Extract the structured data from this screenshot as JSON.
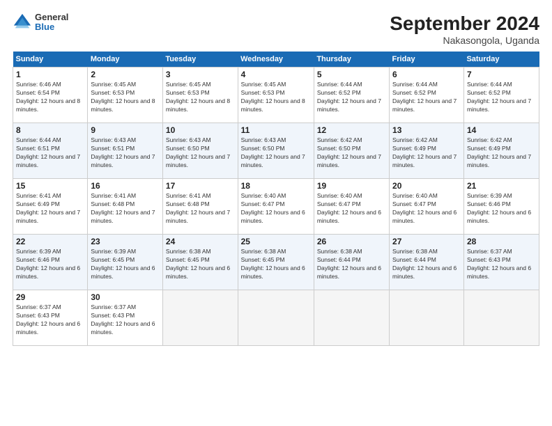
{
  "header": {
    "logo_general": "General",
    "logo_blue": "Blue",
    "month_title": "September 2024",
    "location": "Nakasongola, Uganda"
  },
  "days_of_week": [
    "Sunday",
    "Monday",
    "Tuesday",
    "Wednesday",
    "Thursday",
    "Friday",
    "Saturday"
  ],
  "weeks": [
    [
      {
        "day": 1,
        "sunrise": "6:46 AM",
        "sunset": "6:54 PM",
        "daylight": "12 hours and 8 minutes."
      },
      {
        "day": 2,
        "sunrise": "6:45 AM",
        "sunset": "6:53 PM",
        "daylight": "12 hours and 8 minutes."
      },
      {
        "day": 3,
        "sunrise": "6:45 AM",
        "sunset": "6:53 PM",
        "daylight": "12 hours and 8 minutes."
      },
      {
        "day": 4,
        "sunrise": "6:45 AM",
        "sunset": "6:53 PM",
        "daylight": "12 hours and 8 minutes."
      },
      {
        "day": 5,
        "sunrise": "6:44 AM",
        "sunset": "6:52 PM",
        "daylight": "12 hours and 7 minutes."
      },
      {
        "day": 6,
        "sunrise": "6:44 AM",
        "sunset": "6:52 PM",
        "daylight": "12 hours and 7 minutes."
      },
      {
        "day": 7,
        "sunrise": "6:44 AM",
        "sunset": "6:52 PM",
        "daylight": "12 hours and 7 minutes."
      }
    ],
    [
      {
        "day": 8,
        "sunrise": "6:44 AM",
        "sunset": "6:51 PM",
        "daylight": "12 hours and 7 minutes."
      },
      {
        "day": 9,
        "sunrise": "6:43 AM",
        "sunset": "6:51 PM",
        "daylight": "12 hours and 7 minutes."
      },
      {
        "day": 10,
        "sunrise": "6:43 AM",
        "sunset": "6:50 PM",
        "daylight": "12 hours and 7 minutes."
      },
      {
        "day": 11,
        "sunrise": "6:43 AM",
        "sunset": "6:50 PM",
        "daylight": "12 hours and 7 minutes."
      },
      {
        "day": 12,
        "sunrise": "6:42 AM",
        "sunset": "6:50 PM",
        "daylight": "12 hours and 7 minutes."
      },
      {
        "day": 13,
        "sunrise": "6:42 AM",
        "sunset": "6:49 PM",
        "daylight": "12 hours and 7 minutes."
      },
      {
        "day": 14,
        "sunrise": "6:42 AM",
        "sunset": "6:49 PM",
        "daylight": "12 hours and 7 minutes."
      }
    ],
    [
      {
        "day": 15,
        "sunrise": "6:41 AM",
        "sunset": "6:49 PM",
        "daylight": "12 hours and 7 minutes."
      },
      {
        "day": 16,
        "sunrise": "6:41 AM",
        "sunset": "6:48 PM",
        "daylight": "12 hours and 7 minutes."
      },
      {
        "day": 17,
        "sunrise": "6:41 AM",
        "sunset": "6:48 PM",
        "daylight": "12 hours and 7 minutes."
      },
      {
        "day": 18,
        "sunrise": "6:40 AM",
        "sunset": "6:47 PM",
        "daylight": "12 hours and 6 minutes."
      },
      {
        "day": 19,
        "sunrise": "6:40 AM",
        "sunset": "6:47 PM",
        "daylight": "12 hours and 6 minutes."
      },
      {
        "day": 20,
        "sunrise": "6:40 AM",
        "sunset": "6:47 PM",
        "daylight": "12 hours and 6 minutes."
      },
      {
        "day": 21,
        "sunrise": "6:39 AM",
        "sunset": "6:46 PM",
        "daylight": "12 hours and 6 minutes."
      }
    ],
    [
      {
        "day": 22,
        "sunrise": "6:39 AM",
        "sunset": "6:46 PM",
        "daylight": "12 hours and 6 minutes."
      },
      {
        "day": 23,
        "sunrise": "6:39 AM",
        "sunset": "6:45 PM",
        "daylight": "12 hours and 6 minutes."
      },
      {
        "day": 24,
        "sunrise": "6:38 AM",
        "sunset": "6:45 PM",
        "daylight": "12 hours and 6 minutes."
      },
      {
        "day": 25,
        "sunrise": "6:38 AM",
        "sunset": "6:45 PM",
        "daylight": "12 hours and 6 minutes."
      },
      {
        "day": 26,
        "sunrise": "6:38 AM",
        "sunset": "6:44 PM",
        "daylight": "12 hours and 6 minutes."
      },
      {
        "day": 27,
        "sunrise": "6:38 AM",
        "sunset": "6:44 PM",
        "daylight": "12 hours and 6 minutes."
      },
      {
        "day": 28,
        "sunrise": "6:37 AM",
        "sunset": "6:43 PM",
        "daylight": "12 hours and 6 minutes."
      }
    ],
    [
      {
        "day": 29,
        "sunrise": "6:37 AM",
        "sunset": "6:43 PM",
        "daylight": "12 hours and 6 minutes."
      },
      {
        "day": 30,
        "sunrise": "6:37 AM",
        "sunset": "6:43 PM",
        "daylight": "12 hours and 6 minutes."
      },
      null,
      null,
      null,
      null,
      null
    ]
  ]
}
